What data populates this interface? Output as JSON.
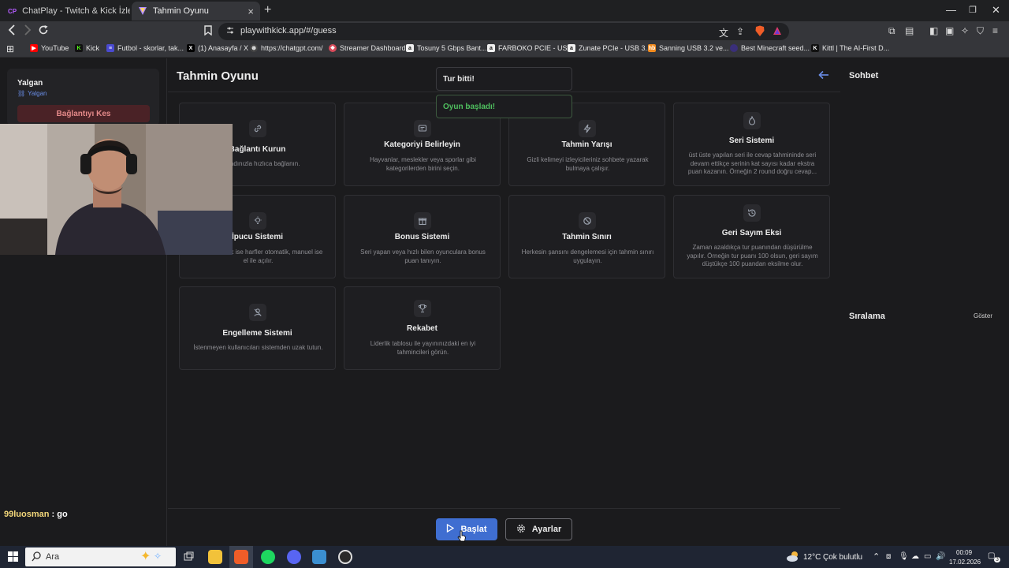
{
  "browser": {
    "tabs": [
      {
        "title": "ChatPlay - Twitch & Kick İzleyici Etkileşi",
        "favicon": "CP",
        "active": false
      },
      {
        "title": "Tahmin Oyunu",
        "favicon": "",
        "active": true
      }
    ],
    "url": "playwithkick.app/#/guess",
    "bookmarks": [
      {
        "label": "YouTube",
        "icon": "youtube-icon",
        "color": "#ff0000"
      },
      {
        "label": "Kick",
        "icon": "kick-icon",
        "color": "#53fc18"
      },
      {
        "label": "Futbol - skorlar, tak...",
        "icon": "futbol-icon",
        "color": "#4a4ad0"
      },
      {
        "label": "(1) Anasayfa / X",
        "icon": "x-icon",
        "color": "#000000"
      },
      {
        "label": "https://chatgpt.com/",
        "icon": "chatgpt-icon",
        "color": "#444444"
      },
      {
        "label": "Streamer Dashboard",
        "icon": "dashboard-icon",
        "color": "#d94a5a"
      },
      {
        "label": "Tosuny 5 Gbps Bant...",
        "icon": "amazon-icon",
        "color": "#f0f0f0"
      },
      {
        "label": "FARBOKO PCIE - US...",
        "icon": "amazon-icon",
        "color": "#f0f0f0"
      },
      {
        "label": "Zunate PCIe - USB 3...",
        "icon": "amazon-icon",
        "color": "#f0f0f0"
      },
      {
        "label": "Sanning USB 3.2 ve...",
        "icon": "hb-icon",
        "color": "#f28b1e"
      },
      {
        "label": "Best Minecraft seed...",
        "icon": "minecraft-icon",
        "color": "#3a2f7a"
      },
      {
        "label": "Kittl | The AI-First D...",
        "icon": "kittl-icon",
        "color": "#111111"
      }
    ]
  },
  "left": {
    "username": "Yalgan",
    "handle": "Yalgan",
    "disconnect_label": "Bağlantıyı Kes"
  },
  "main": {
    "title": "Tahmin Oyunu",
    "toasts": [
      {
        "text": "Tur bitti!",
        "color": "#ececec"
      },
      {
        "text": "Oyun başladı!",
        "color": "#4fbf5f"
      }
    ],
    "cards": [
      {
        "title": "Bağlantı Kurun",
        "desc": "...ıcı adınızla hızlıca bağlanın.",
        "icon": "link-icon"
      },
      {
        "title": "Kategoriyi Belirleyin",
        "desc": "Hayvanlar, meslekler veya sporlar gibi kategorilerden birini seçin.",
        "icon": "message-icon"
      },
      {
        "title": "Tahmin Yarışı",
        "desc": "Gizli kelimeyi izleyicileriniz sohbete yazarak bulmaya çalışır.",
        "icon": "lightning-icon"
      },
      {
        "title": "Seri Sistemi",
        "desc": "üst üste yapılan seri ile cevap tahmininde seri devam ettikçe serinin kat sayısı kadar ekstra puan kazanın. Örneğin 2 round doğru cevap...",
        "icon": "flame-icon"
      },
      {
        "title": "İpucu Sistemi",
        "desc": "...dar otomatik ise harfler otomatik, manuel ise el ile açılır.",
        "icon": "bulb-icon"
      },
      {
        "title": "Bonus Sistemi",
        "desc": "Seri yapan veya hızlı bilen oyunculara bonus puan tanıyın.",
        "icon": "gift-icon"
      },
      {
        "title": "Tahmin Sınırı",
        "desc": "Herkesin şansını dengelemesi için tahmin sınırı uygulayın.",
        "icon": "ban-icon"
      },
      {
        "title": "Geri Sayım Eksi",
        "desc": "Zaman azaldıkça tur puanından düşürülme yapılır. Örneğin tur puanı 100 olsun, geri sayım düştükçe 100 puandan eksilme olur.",
        "icon": "history-icon"
      },
      {
        "title": "Engelleme Sistemi",
        "desc": "İstenmeyen kullanıcıları sistemden uzak tutun.",
        "icon": "user-block-icon"
      },
      {
        "title": "Rekabet",
        "desc": "Liderlik tablosu ile yayınınızdaki en iyi tahmincileri görün.",
        "icon": "trophy-icon"
      }
    ],
    "start_label": "Başlat",
    "settings_label": "Ayarlar"
  },
  "right": {
    "chat_title": "Sohbet",
    "ranking_title": "Sıralama",
    "ranking_show": "Göster"
  },
  "overlay": {
    "chat_user": "99luosman",
    "chat_message": " : go"
  },
  "taskbar": {
    "search_placeholder": "Ara",
    "weather_temp": "12°C",
    "weather_desc": "Çok bulutlu",
    "time": "00:09",
    "date": "17.02.2026",
    "notification_count": "3"
  }
}
